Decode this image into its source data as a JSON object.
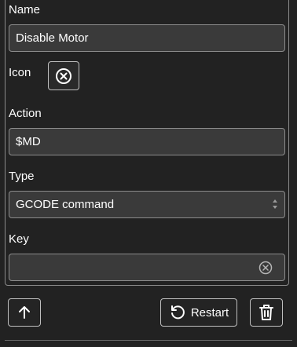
{
  "fields": {
    "name_label": "Name",
    "name_value": "Disable Motor",
    "icon_label": "Icon",
    "icon_value": "close-circle-icon",
    "action_label": "Action",
    "action_value": "$MD",
    "type_label": "Type",
    "type_value": "GCODE command",
    "key_label": "Key",
    "key_value": ""
  },
  "toolbar": {
    "restart_label": "Restart"
  },
  "icons": {
    "move_up": "arrow-up-icon",
    "restart": "restart-icon",
    "delete": "trash-icon",
    "clear": "clear-circle-icon",
    "select": "select-arrows-icon"
  }
}
